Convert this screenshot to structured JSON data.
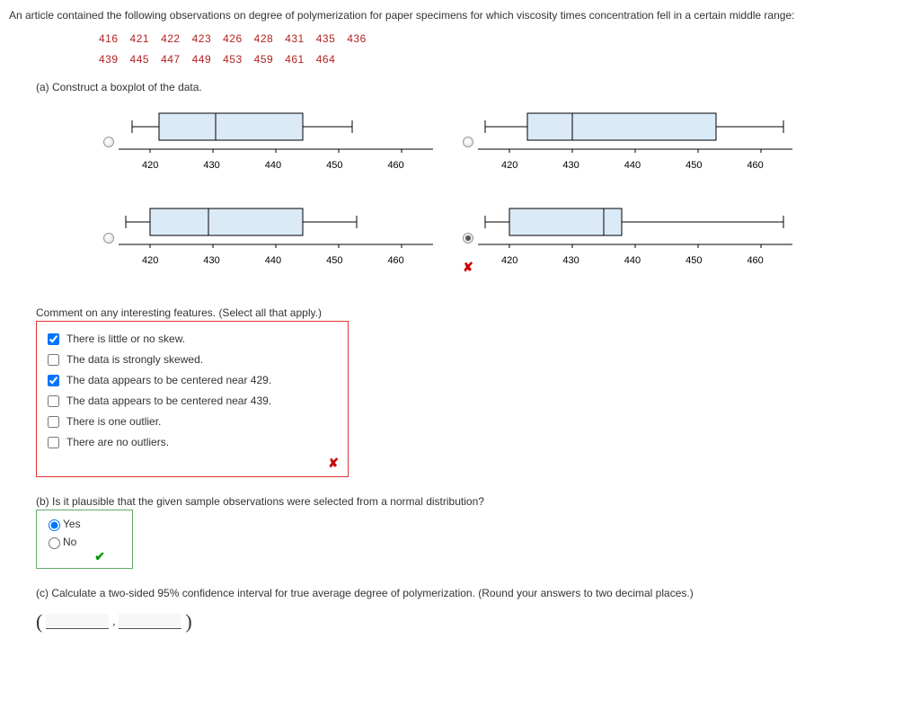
{
  "intro": "An article contained the following observations on degree of polymerization for paper specimens for which viscosity times concentration fell in a certain middle range:",
  "data_rows": [
    [
      "416",
      "421",
      "422",
      "423",
      "426",
      "428",
      "431",
      "435",
      "436"
    ],
    [
      "439",
      "445",
      "447",
      "449",
      "453",
      "459",
      "461",
      "464"
    ]
  ],
  "part_a": "(a) Construct a boxplot of the data.",
  "axis_ticks": [
    "420",
    "430",
    "440",
    "450",
    "460"
  ],
  "plot4_wrong": "✘",
  "comment_q": "Comment on any interesting features. (Select all that apply.)",
  "checkboxes": [
    {
      "label": "There is little or no skew.",
      "checked": true
    },
    {
      "label": "The data is strongly skewed.",
      "checked": false
    },
    {
      "label": "The data appears to be centered near 429.",
      "checked": true
    },
    {
      "label": "The data appears to be centered near 439.",
      "checked": false
    },
    {
      "label": "There is one outlier.",
      "checked": false
    },
    {
      "label": "There are no outliers.",
      "checked": false
    }
  ],
  "checkbox_wrong": "✘",
  "part_b": "(b) Is it plausible that the given sample observations were selected from a normal distribution?",
  "yes": "Yes",
  "no": "No",
  "yes_selected": true,
  "check_mark": "✔",
  "part_c": "(c) Calculate a two-sided 95% confidence interval for true average degree of polymerization. (Round your answers to two decimal places.)",
  "paren_open": "(",
  "paren_close": ")",
  "comma": ",",
  "chart_data": {
    "type": "boxplot",
    "raw_values": [
      416,
      421,
      422,
      423,
      426,
      428,
      431,
      435,
      436,
      439,
      445,
      447,
      449,
      453,
      459,
      461,
      464
    ],
    "five_number_summary": {
      "min": 416,
      "q1": 423,
      "median": 436,
      "q3": 449,
      "max": 464
    },
    "axis_range": [
      415,
      465
    ],
    "candidates": [
      {
        "min": 417,
        "q1": 421,
        "median": 430,
        "q3": 444,
        "wmax": 452
      },
      {
        "min": 416,
        "q1": 423,
        "median": 430,
        "q3": 453,
        "wmax": 464
      },
      {
        "min": 416,
        "q1": 420,
        "median": 429,
        "q3": 444,
        "wmax": 453
      },
      {
        "min": 416,
        "q1": 420,
        "median": 435,
        "q3": 438,
        "wmax": 464
      }
    ]
  }
}
